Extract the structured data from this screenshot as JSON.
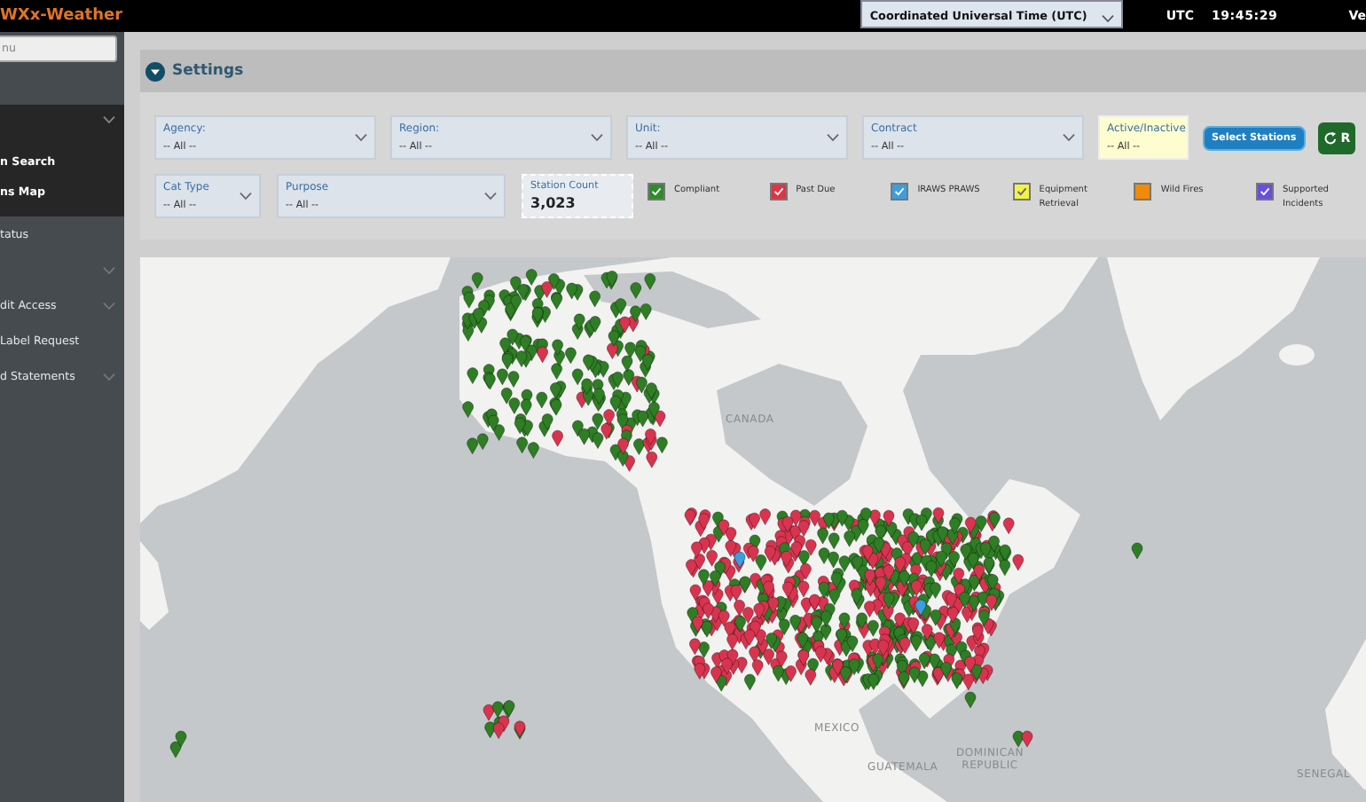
{
  "header": {
    "brand": "WXx-Weather",
    "time_zone": {
      "value": "Coordinated Universal Time (UTC)"
    },
    "clock_zone": "UTC",
    "clock_time": "19:45:29",
    "user": "Ve"
  },
  "sidebar": {
    "search": {
      "placeholder": "nu"
    },
    "items": [
      {
        "kind": "group",
        "expanded": true,
        "children": [
          {
            "label": "n Search"
          },
          {
            "label": "ns Map"
          }
        ]
      },
      {
        "kind": "link",
        "label": "tatus"
      },
      {
        "kind": "group",
        "expanded": false
      },
      {
        "kind": "group",
        "label": "dit Access",
        "expanded": false
      },
      {
        "kind": "link",
        "label": "Label Request"
      },
      {
        "kind": "group",
        "label": "d Statements",
        "expanded": false
      }
    ]
  },
  "settings": {
    "title": "Settings",
    "filters_row_1": [
      {
        "kind": "select",
        "label": "Agency:",
        "value": "-- All --"
      },
      {
        "kind": "select",
        "label": "Region:",
        "value": "-- All --"
      },
      {
        "kind": "select",
        "label": "Unit:",
        "value": "-- All --"
      },
      {
        "kind": "select",
        "label": "Contract",
        "value": "-- All --"
      },
      {
        "kind": "highlight",
        "label": "Active/Inactive",
        "value": "-- All --"
      }
    ],
    "buttons": [
      {
        "kind": "primary",
        "label": "Select Stations"
      },
      {
        "kind": "refresh",
        "label": "R"
      }
    ],
    "filters_row_2": [
      {
        "kind": "select",
        "label": "Cat Type",
        "value": "-- All --"
      },
      {
        "kind": "select",
        "label": "Purpose",
        "value": "-- All --"
      }
    ],
    "station_count": {
      "label": "Station Count",
      "value": "3,023"
    },
    "legend": [
      {
        "label": "Compliant",
        "color": "#2e8b2e",
        "checked": true
      },
      {
        "label": "Past Due",
        "color": "#dc3545",
        "checked": true
      },
      {
        "label": "IRAWS PRAWS",
        "color": "#3a9ee0",
        "checked": true
      },
      {
        "label": "Equipment Retrieval",
        "color": "#f2f24a",
        "checked": true
      },
      {
        "label": "Wild Fires",
        "color": "#f08a0a",
        "checked": false
      },
      {
        "label": "Supported Incidents",
        "color": "#6a4ee0",
        "checked": true
      }
    ]
  },
  "map": {
    "labels": [
      "CANADA",
      "MEXICO",
      "GUATEMALA",
      "DOMINICAN REPUBLIC",
      "SENEGAL"
    ]
  }
}
